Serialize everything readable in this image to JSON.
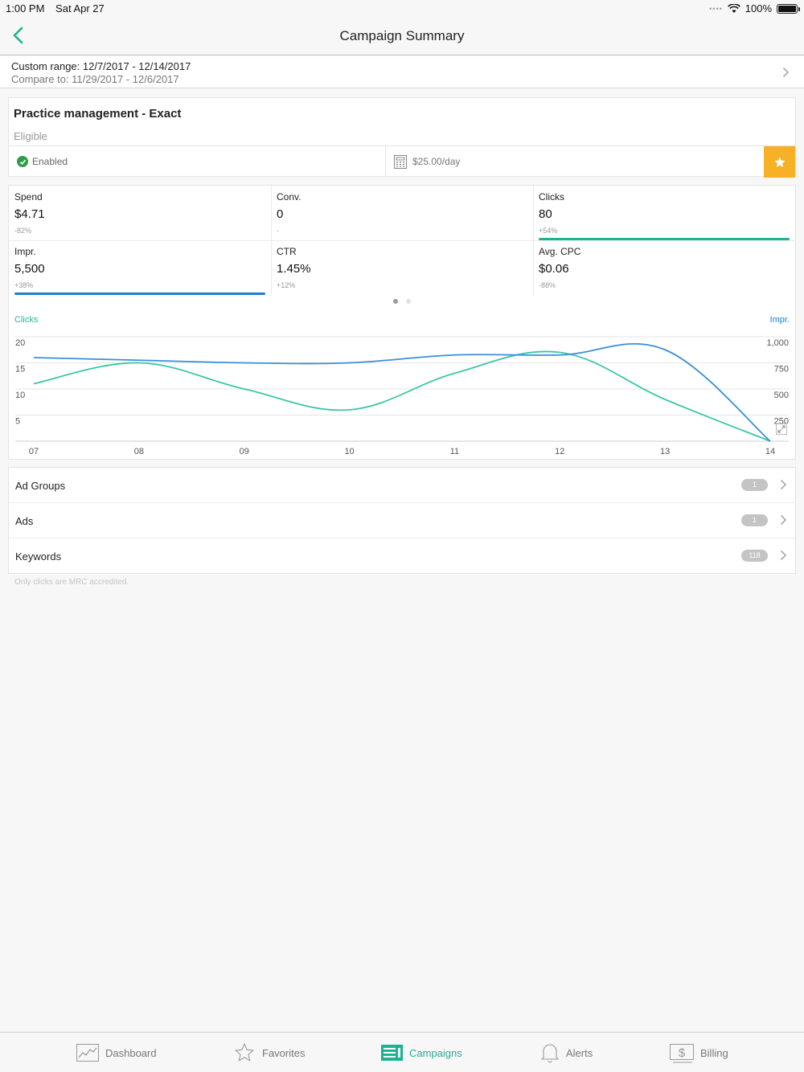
{
  "status_bar": {
    "time": "1:00 PM",
    "date": "Sat Apr 27",
    "battery": "100%"
  },
  "nav": {
    "title": "Campaign Summary"
  },
  "date_range": {
    "custom_range": "Custom range: 12/7/2017 - 12/14/2017",
    "compare_to": "Compare to: 11/29/2017 -  12/6/2017"
  },
  "campaign": {
    "name": "Practice management - Exact",
    "status": "Eligible",
    "state": "Enabled",
    "budget": "$25.00/day"
  },
  "metrics": [
    {
      "label": "Spend",
      "value": "$4.71",
      "delta": "-82%"
    },
    {
      "label": "Conv.",
      "value": "0",
      "delta": "-"
    },
    {
      "label": "Clicks",
      "value": "80",
      "delta": "+54%"
    },
    {
      "label": "Impr.",
      "value": "5,500",
      "delta": "+38%"
    },
    {
      "label": "CTR",
      "value": "1.45%",
      "delta": "+12%"
    },
    {
      "label": "Avg. CPC",
      "value": "$0.06",
      "delta": "-88%"
    }
  ],
  "chart_data": {
    "type": "line",
    "x": [
      "07",
      "08",
      "09",
      "10",
      "11",
      "12",
      "13",
      "14"
    ],
    "left_axis_label": "Clicks",
    "right_axis_label": "Impr.",
    "left_ticks": [
      "20",
      "15",
      "10",
      "5"
    ],
    "right_ticks": [
      "1,000",
      "750",
      "500",
      "250"
    ],
    "ylim_left": [
      0,
      20
    ],
    "ylim_right": [
      0,
      1000
    ],
    "series": [
      {
        "name": "Clicks",
        "axis": "left",
        "color": "#3cc6a8",
        "values": [
          11,
          15,
          10,
          6,
          13,
          17,
          8,
          0
        ]
      },
      {
        "name": "Impr.",
        "axis": "right",
        "color": "#3a8fd8",
        "values": [
          800,
          775,
          750,
          750,
          825,
          825,
          875,
          0
        ]
      }
    ],
    "grid": true
  },
  "lists": [
    {
      "label": "Ad Groups",
      "count": "1"
    },
    {
      "label": "Ads",
      "count": "1"
    },
    {
      "label": "Keywords",
      "count": "118"
    }
  ],
  "footnote": "Only clicks are MRC accredited.",
  "tabs": [
    {
      "label": "Dashboard",
      "icon": "chart-icon"
    },
    {
      "label": "Favorites",
      "icon": "star-icon"
    },
    {
      "label": "Campaigns",
      "icon": "campaigns-icon",
      "active": true
    },
    {
      "label": "Alerts",
      "icon": "bell-icon"
    },
    {
      "label": "Billing",
      "icon": "billing-icon"
    }
  ],
  "colors": {
    "accent": "#1ab394",
    "impr": "#1a7fd1",
    "star": "#f6b126",
    "enabled": "#2e9d49"
  }
}
